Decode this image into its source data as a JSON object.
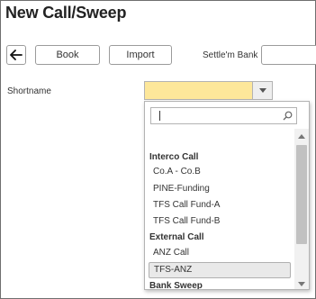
{
  "page": {
    "title": "New Call/Sweep"
  },
  "toolbar": {
    "back_icon": "arrow-left-icon",
    "book_label": "Book",
    "import_label": "Import",
    "settle_bank_label": "Settle'm Bank",
    "settle_bank_value": ""
  },
  "form": {
    "shortname_label": "Shortname",
    "shortname_value": "",
    "highlight_color": "#fde79a"
  },
  "dropdown": {
    "search_value": "",
    "groups": [
      {
        "label": "Interco Call",
        "options": [
          "Co.A - Co.B",
          "PINE-Funding",
          "TFS Call Fund-A",
          "TFS Call Fund-B"
        ]
      },
      {
        "label": "External Call",
        "options": [
          "ANZ Call",
          "TFS-ANZ"
        ]
      },
      {
        "label": "Bank Sweep",
        "options": []
      }
    ],
    "selected_option": "TFS-ANZ"
  }
}
